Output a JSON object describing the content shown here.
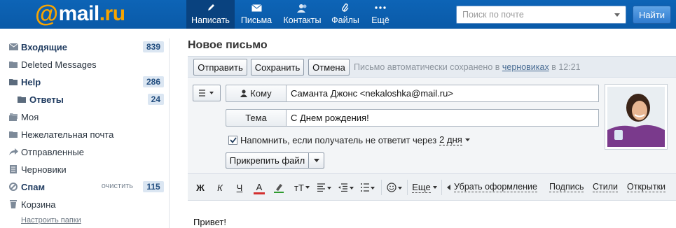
{
  "header": {
    "logo_at": "@",
    "logo_mail": "mail",
    "logo_dot": ".ru",
    "nav": [
      {
        "label": "Написать",
        "icon": "pencil-icon",
        "active": true
      },
      {
        "label": "Письма",
        "icon": "envelope-icon",
        "active": false
      },
      {
        "label": "Контакты",
        "icon": "contacts-icon",
        "active": false
      },
      {
        "label": "Файлы",
        "icon": "paperclip-icon",
        "active": false
      },
      {
        "label": "Ещё",
        "icon": "more-dots-icon",
        "active": false
      }
    ],
    "search_placeholder": "Поиск по почте",
    "search_button": "Найти"
  },
  "sidebar": {
    "folders": [
      {
        "label": "Входящие",
        "icon": "envelope-icon",
        "count": "839",
        "bold": true
      },
      {
        "label": "Deleted Messages",
        "icon": "folder-icon",
        "count": "",
        "bold": false
      },
      {
        "label": "Help",
        "icon": "folder-icon",
        "count": "286",
        "bold": true
      },
      {
        "label": "Ответы",
        "icon": "folder-icon",
        "count": "24",
        "bold": true
      },
      {
        "label": "Моя",
        "icon": "folders-icon",
        "count": "",
        "bold": false
      },
      {
        "label": "Нежелательная почта",
        "icon": "folder-icon",
        "count": "",
        "bold": false
      },
      {
        "label": "Отправленные",
        "icon": "sent-arrow-icon",
        "count": "",
        "bold": false
      },
      {
        "label": "Черновики",
        "icon": "drafts-icon",
        "count": "",
        "bold": false
      },
      {
        "label": "Спам",
        "icon": "spam-icon",
        "count": "115",
        "bold": true,
        "action": "очистить"
      },
      {
        "label": "Корзина",
        "icon": "trash-icon",
        "count": "",
        "bold": false
      }
    ],
    "setup_link": "Настроить папки"
  },
  "compose": {
    "title": "Новое письмо",
    "toolbar": {
      "send": "Отправить",
      "save": "Сохранить",
      "cancel": "Отмена",
      "autosave_prefix": "Письмо автоматически сохранено в",
      "autosave_link": "черновиках",
      "autosave_suffix": "в 12:21"
    },
    "to_label": "Кому",
    "to_value": "Саманта Джонс <nekaloshka@mail.ru>",
    "subject_label": "Тема",
    "subject_value": "С Днем рождения!",
    "remind_checked": true,
    "remind_text": "Напомнить, если получатель не ответит через",
    "remind_days": "2 дня",
    "attach_label": "Прикрепить файл",
    "format": {
      "bold": "Ж",
      "italic": "К",
      "underline": "Ч",
      "font_color": "А",
      "font_size": "тТ",
      "more": "Еще",
      "clear": "Убрать оформление",
      "signature": "Подпись",
      "styles": "Стили",
      "postcards": "Открытки"
    },
    "body": "Привет!"
  },
  "colors": {
    "header": "#0d64b6",
    "logo_accent": "#f7a400",
    "badge_bg": "#dbe6f2"
  }
}
